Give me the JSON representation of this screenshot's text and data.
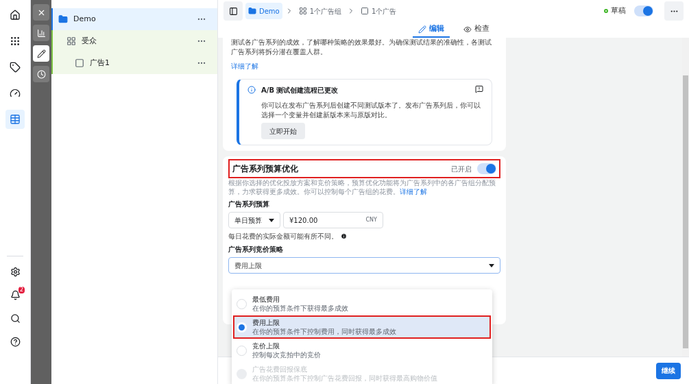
{
  "icon_rail": {
    "top": [
      {
        "kind": "home",
        "selected": false
      },
      {
        "kind": "apps",
        "selected": false
      },
      {
        "kind": "tag",
        "selected": false
      },
      {
        "kind": "gauge",
        "selected": false
      },
      {
        "kind": "table",
        "selected": true
      }
    ],
    "bottom": [
      {
        "kind": "settings"
      },
      {
        "kind": "bell",
        "badge": "2"
      },
      {
        "kind": "search"
      },
      {
        "kind": "help"
      }
    ]
  },
  "tool_rail": [
    {
      "kind": "close",
      "selected": false
    },
    {
      "kind": "chart",
      "selected": false
    },
    {
      "kind": "edit",
      "selected": true
    },
    {
      "kind": "history",
      "selected": false
    }
  ],
  "tree": [
    {
      "kind": "campaign",
      "label": "Demo",
      "selected": true,
      "children": [
        {
          "kind": "adset",
          "label": "受众",
          "selected": false,
          "children": [
            {
              "kind": "ad",
              "label": "广告1",
              "selected": false
            }
          ]
        }
      ]
    }
  ],
  "breadcrumb": [
    {
      "kind": "campaign",
      "label": "Demo",
      "selected": true
    },
    {
      "kind": "adset",
      "label": "1个广告组",
      "selected": false
    },
    {
      "kind": "ad",
      "label": "1个广告",
      "selected": false
    }
  ],
  "status": {
    "label": "草稿",
    "on": true
  },
  "tabs": [
    {
      "kind": "edit",
      "label": "编辑",
      "selected": true
    },
    {
      "kind": "review",
      "label": "检查",
      "selected": false
    }
  ],
  "ab_test": {
    "description": "测试各广告系列的成效，了解哪种策略的效果最好。为确保测试结果的准确性，各测试广告系列将拆分潜在覆盖人群。",
    "link": "详细了解",
    "notice": {
      "title": "A/B 测试创建流程已更改",
      "body": "你可以在发布广告系列后创建不同测试版本了。发布广告系列后，你可以选择一个变量并创建新版本来与原版对比。",
      "button": "立即开始"
    }
  },
  "budget_optimization": {
    "title": "广告系列预算优化",
    "highlighted": true,
    "toggle_label": "已开启",
    "on": true,
    "description": "根据你选择的优化投放方案和竞价策略，预算优化功能将为广告系列中的各广告组分配预算，力求获得更多成效。你可以控制每个广告组的花费。",
    "link": "详细了解",
    "budget_label": "广告系列预算",
    "budget_type": "单日预算",
    "amount": "¥120.00",
    "currency": "CNY",
    "note": "每日花费的实际金额可能有所不同。",
    "bid_label": "广告系列竞价策略",
    "bid_value": "费用上限"
  },
  "bid_options": [
    {
      "title": "最低费用",
      "subtitle": "在你的预算条件下获得最多成效",
      "selected": false,
      "disabled": false,
      "highlighted": false
    },
    {
      "title": "费用上限",
      "subtitle": "在你的预算条件下控制费用，同时获得最多成效",
      "selected": true,
      "disabled": false,
      "highlighted": true
    },
    {
      "title": "竞价上限",
      "subtitle": "控制每次竞拍中的竞价",
      "selected": false,
      "disabled": false,
      "highlighted": false
    },
    {
      "title": "广告花费回报保底",
      "subtitle": "在你的预算条件下控制广告花费回报，同时获得最高购物价值",
      "selected": false,
      "disabled": true,
      "highlighted": false
    }
  ],
  "footer": {
    "button": "继续"
  }
}
